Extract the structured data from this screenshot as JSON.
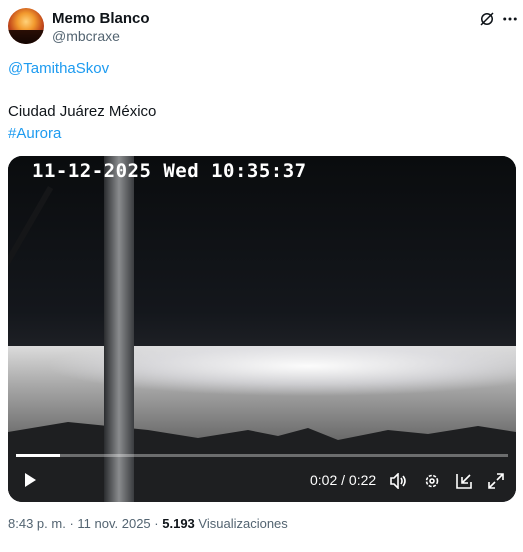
{
  "author": {
    "name": "Memo Blanco",
    "handle": "@mbcraxe"
  },
  "tweet": {
    "mention": "@TamithaSkov",
    "line": "Ciudad Juárez México",
    "hashtag": "#Aurora"
  },
  "video": {
    "timestamp_overlay": "11-12-2025 Wed 10:35:37",
    "time_display": "0:02 / 0:22",
    "progress_fraction": 0.09
  },
  "footer": {
    "time": "8:43 p. m.",
    "sep1": "·",
    "date": "11 nov. 2025",
    "sep2": "·",
    "views_count": "5.193",
    "views_label": "Visualizaciones"
  },
  "colors": {
    "link": "#1d9bf0",
    "muted": "#536471",
    "text": "#0f1419"
  },
  "icons": [
    "grok-icon",
    "more-icon",
    "play-icon",
    "volume-icon",
    "settings-icon",
    "pip-icon",
    "fullscreen-icon"
  ]
}
